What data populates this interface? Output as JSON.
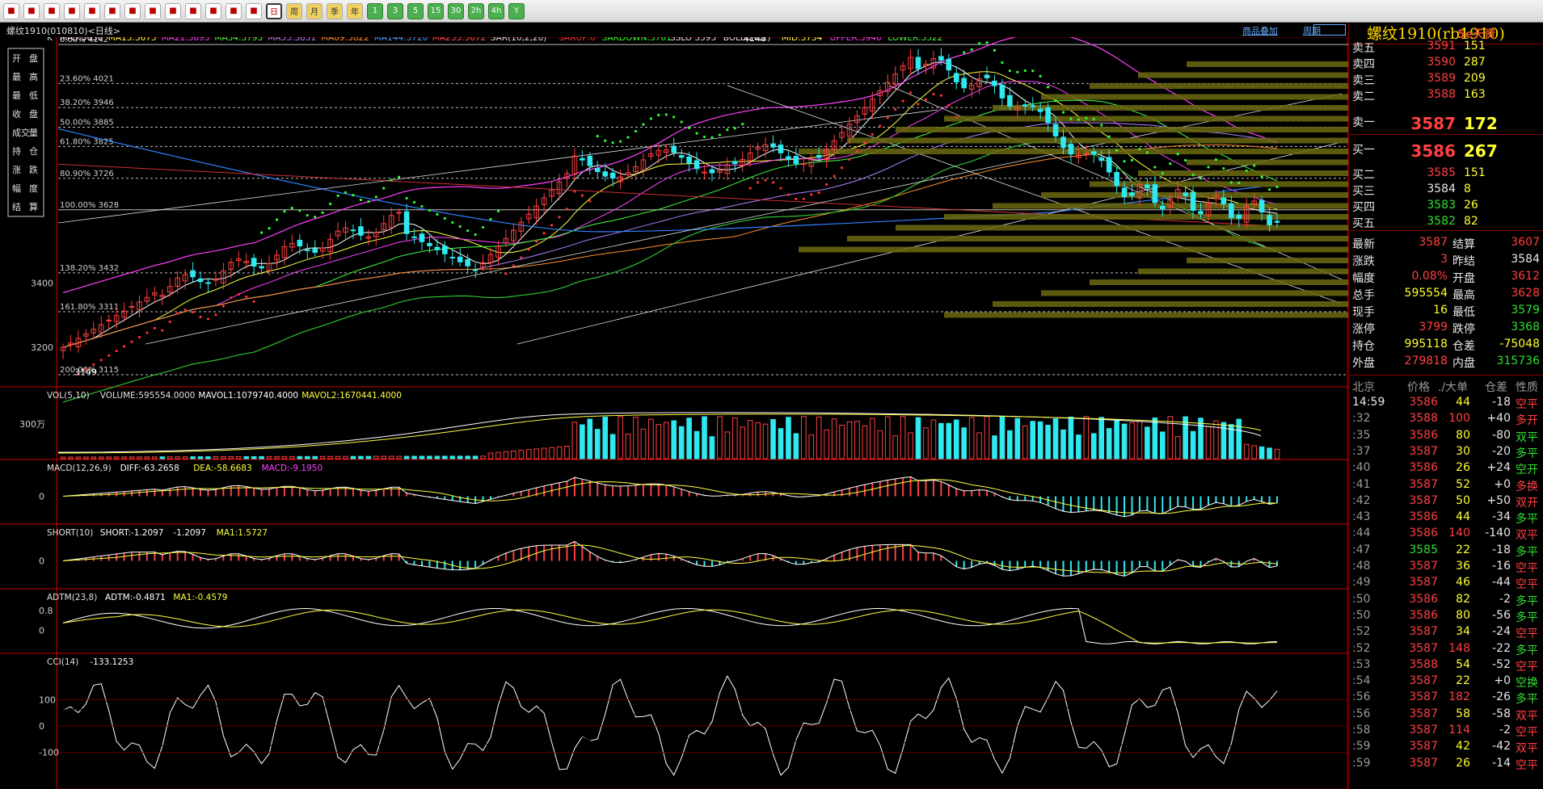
{
  "toolbar": {
    "icons": [
      "home-icon",
      "back-icon",
      "cards-icon",
      "refresh-icon",
      "search-icon",
      "zoom-icon",
      "sort-icon",
      "pen-icon",
      "draw-icon",
      "filter-icon",
      "list-icon",
      "chart-icon",
      "kline-icon",
      "daily-icon",
      "weekly-icon",
      "monthly-icon",
      "quarterly-icon",
      "year-icon",
      "1min-icon",
      "3min-icon",
      "5min-icon",
      "15min-icon",
      "30min-icon",
      "2h-icon",
      "4h-icon",
      "year2-icon"
    ],
    "labels": [
      "",
      "",
      "",
      "",
      "",
      "",
      "",
      "",
      "",
      "",
      "",
      "",
      "",
      "日",
      "周",
      "月",
      "季",
      "年",
      "1",
      "3",
      "5",
      "15",
      "30",
      "2h",
      "4h",
      "Y"
    ]
  },
  "title": {
    "symbol_label": "螺纹1910(010810)<日线>",
    "link_overlay": "商品叠加",
    "link_period": "周期"
  },
  "main_legend": [
    {
      "t": "K",
      "c": "#e0e0e0"
    },
    {
      "t": "MA5:3630",
      "c": "#ffffff"
    },
    {
      "t": "MA13:3675",
      "c": "#ffff40"
    },
    {
      "t": "MA21:3693",
      "c": "#ff40ff"
    },
    {
      "t": "MA34:3793",
      "c": "#40ff40"
    },
    {
      "t": "MA55:3851",
      "c": "#b080ff"
    },
    {
      "t": "MA89:3822",
      "c": "#ff9030"
    },
    {
      "t": "MA144:3720",
      "c": "#40a0ff"
    },
    {
      "t": "MA233:3672",
      "c": "#ff5050"
    },
    {
      "t": "SAR(10,2,20)",
      "c": "#e0e0e0"
    },
    {
      "t": "SARUP:0",
      "c": "#ff3030"
    },
    {
      "t": "SARDOWN:3761",
      "c": "#30ff30"
    },
    {
      "t": "SSLO 3595",
      "c": "#e0e0e0"
    },
    {
      "t": "BOLL(26,2)",
      "c": "#e0e0e0"
    },
    {
      "t": "MID:3734",
      "c": "#ffff40"
    },
    {
      "t": "UPPER:3946",
      "c": "#ff40ff"
    },
    {
      "t": "LOWER:3522",
      "c": "#40ff40"
    }
  ],
  "info_box": [
    [
      "开",
      "盘"
    ],
    [
      "最",
      "高"
    ],
    [
      "最",
      "低"
    ],
    [
      "收",
      "盘"
    ],
    [
      "成交",
      "量"
    ],
    [
      "持",
      "仓"
    ],
    [
      "涨",
      "跌"
    ],
    [
      "幅",
      "度"
    ],
    [
      "结",
      "算"
    ]
  ],
  "fib_levels": [
    {
      "label": "0.00% 4142",
      "v": 4142
    },
    {
      "label": "23.60% 4021",
      "v": 4021
    },
    {
      "label": "38.20% 3946",
      "v": 3946
    },
    {
      "label": "50.00% 3885",
      "v": 3885
    },
    {
      "label": "61.80% 3825",
      "v": 3825
    },
    {
      "label": "80.90% 3726",
      "v": 3726
    },
    {
      "label": "100.00% 3628",
      "v": 3628
    },
    {
      "label": "138.20% 3432",
      "v": 3432
    },
    {
      "label": "161.80% 3311",
      "v": 3311
    },
    {
      "label": "200.00% 3115",
      "v": 3115
    }
  ],
  "price_axis": {
    "labels": [
      "3400",
      "3200"
    ],
    "values": [
      3400,
      3200
    ]
  },
  "annotations": {
    "high": "4148",
    "low": "3149"
  },
  "volume": {
    "legend": [
      {
        "t": "VOL(5,10)",
        "c": "#e0e0e0"
      },
      {
        "t": "VOLUME:595554.0000",
        "c": "#e0e0e0"
      },
      {
        "t": "MAVOL1:1079740.4000",
        "c": "#ffffff"
      },
      {
        "t": "MAVOL2:1670441.4000",
        "c": "#ffff40"
      }
    ],
    "axis_label": "300万"
  },
  "macd": {
    "legend": [
      {
        "t": "MACD(12,26,9)",
        "c": "#e0e0e0"
      },
      {
        "t": "DIFF:-63.2658",
        "c": "#ffffff"
      },
      {
        "t": "DEA:-58.6683",
        "c": "#ffff40"
      },
      {
        "t": "MACD:-9.1950",
        "c": "#ff40ff"
      }
    ],
    "axis_label": "0"
  },
  "short": {
    "legend": [
      {
        "t": "SHORT(10)",
        "c": "#e0e0e0"
      },
      {
        "t": "SHORT:-1.2097",
        "c": "#ffffff"
      },
      {
        "t": "-1.2097",
        "c": "#ffffff"
      },
      {
        "t": "MA1:1.5727",
        "c": "#ffff40"
      }
    ],
    "axis_label": "0"
  },
  "adtm": {
    "legend": [
      {
        "t": "ADTM(23,8)",
        "c": "#e0e0e0"
      },
      {
        "t": "ADTM:-0.4871",
        "c": "#ffffff"
      },
      {
        "t": "MA1:-0.4579",
        "c": "#ffff40"
      }
    ],
    "axis_labels": [
      "0.8",
      "0"
    ]
  },
  "cci": {
    "legend": [
      {
        "t": "CCI(14)",
        "c": "#e0e0e0"
      },
      {
        "t": "-133.1253",
        "c": "#ffffff"
      }
    ],
    "axis_labels": [
      "100",
      "0",
      "-100"
    ]
  },
  "panel": {
    "title": "螺纹1910(rb1910)",
    "logo": "5e天资",
    "asks": [
      {
        "l": "卖五",
        "p": "3591",
        "v": "151"
      },
      {
        "l": "卖四",
        "p": "3590",
        "v": "287"
      },
      {
        "l": "卖三",
        "p": "3589",
        "v": "209"
      },
      {
        "l": "卖二",
        "p": "3588",
        "v": "163"
      },
      {
        "l": "卖一",
        "p": "3587",
        "v": "172"
      }
    ],
    "bids": [
      {
        "l": "买一",
        "p": "3586",
        "v": "267"
      },
      {
        "l": "买二",
        "p": "3585",
        "v": "151"
      },
      {
        "l": "买三",
        "p": "3584",
        "v": "8"
      },
      {
        "l": "买四",
        "p": "3583",
        "v": "26"
      },
      {
        "l": "买五",
        "p": "3582",
        "v": "82"
      }
    ],
    "stats": [
      {
        "l1": "最新",
        "v1": "3587",
        "c1": "red",
        "l2": "结算",
        "v2": "3607",
        "c2": "red"
      },
      {
        "l1": "涨跌",
        "v1": "3",
        "c1": "red",
        "l2": "昨结",
        "v2": "3584",
        "c2": "wht"
      },
      {
        "l1": "幅度",
        "v1": "0.08%",
        "c1": "red",
        "l2": "开盘",
        "v2": "3612",
        "c2": "red"
      },
      {
        "l1": "总手",
        "v1": "595554",
        "c1": "yel",
        "l2": "最高",
        "v2": "3628",
        "c2": "red"
      },
      {
        "l1": "现手",
        "v1": "16",
        "c1": "yel",
        "l2": "最低",
        "v2": "3579",
        "c2": "grn"
      },
      {
        "l1": "涨停",
        "v1": "3799",
        "c1": "red",
        "l2": "跌停",
        "v2": "3368",
        "c2": "grn"
      },
      {
        "l1": "持仓",
        "v1": "995118",
        "c1": "yel",
        "l2": "仓差",
        "v2": "-75048",
        "c2": "yel"
      },
      {
        "l1": "外盘",
        "v1": "279818",
        "c1": "red",
        "l2": "内盘",
        "v2": "315736",
        "c2": "grn"
      }
    ],
    "tick_header": {
      "c1": "北京",
      "c2": "价格",
      "c3": "./大单",
      "c4": "仓差",
      "c5": "性质"
    },
    "ticks": [
      {
        "t": "14:59",
        "p": "3586",
        "v": "44",
        "d": "-18",
        "n": "空平",
        "nc": "red"
      },
      {
        "t": ":32",
        "p": "3588",
        "v": "100",
        "d": "+40",
        "n": "多开",
        "nc": "red"
      },
      {
        "t": ":35",
        "p": "3586",
        "v": "80",
        "d": "-80",
        "n": "双平",
        "nc": "grn"
      },
      {
        "t": ":37",
        "p": "3587",
        "v": "30",
        "d": "-20",
        "n": "多平",
        "nc": "grn"
      },
      {
        "t": ":40",
        "p": "3586",
        "v": "26",
        "d": "+24",
        "n": "空开",
        "nc": "grn"
      },
      {
        "t": ":41",
        "p": "3587",
        "v": "52",
        "d": "+0",
        "n": "多换",
        "nc": "red"
      },
      {
        "t": ":42",
        "p": "3587",
        "v": "50",
        "d": "+50",
        "n": "双开",
        "nc": "red"
      },
      {
        "t": ":43",
        "p": "3586",
        "v": "44",
        "d": "-34",
        "n": "多平",
        "nc": "grn"
      },
      {
        "t": ":44",
        "p": "3586",
        "v": "140",
        "d": "-140",
        "n": "双平",
        "nc": "red"
      },
      {
        "t": ":47",
        "p": "3585",
        "v": "22",
        "d": "-18",
        "n": "多平",
        "nc": "grn"
      },
      {
        "t": ":48",
        "p": "3587",
        "v": "36",
        "d": "-16",
        "n": "空平",
        "nc": "red"
      },
      {
        "t": ":49",
        "p": "3587",
        "v": "46",
        "d": "-44",
        "n": "空平",
        "nc": "red"
      },
      {
        "t": ":50",
        "p": "3586",
        "v": "82",
        "d": "-2",
        "n": "多平",
        "nc": "grn"
      },
      {
        "t": ":50",
        "p": "3586",
        "v": "80",
        "d": "-56",
        "n": "多平",
        "nc": "grn"
      },
      {
        "t": ":52",
        "p": "3587",
        "v": "34",
        "d": "-24",
        "n": "空平",
        "nc": "red"
      },
      {
        "t": ":52",
        "p": "3587",
        "v": "148",
        "d": "-22",
        "n": "多平",
        "nc": "grn"
      },
      {
        "t": ":53",
        "p": "3588",
        "v": "54",
        "d": "-52",
        "n": "空平",
        "nc": "red"
      },
      {
        "t": ":54",
        "p": "3587",
        "v": "22",
        "d": "+0",
        "n": "空换",
        "nc": "grn"
      },
      {
        "t": ":56",
        "p": "3587",
        "v": "182",
        "d": "-26",
        "n": "多平",
        "nc": "grn"
      },
      {
        "t": ":56",
        "p": "3587",
        "v": "58",
        "d": "-58",
        "n": "双平",
        "nc": "red"
      },
      {
        "t": ":58",
        "p": "3587",
        "v": "114",
        "d": "-2",
        "n": "空平",
        "nc": "red"
      },
      {
        "t": ":59",
        "p": "3587",
        "v": "42",
        "d": "-42",
        "n": "双平",
        "nc": "red"
      },
      {
        "t": ":59",
        "p": "3587",
        "v": "26",
        "d": "-14",
        "n": "空平",
        "nc": "red"
      }
    ]
  }
}
